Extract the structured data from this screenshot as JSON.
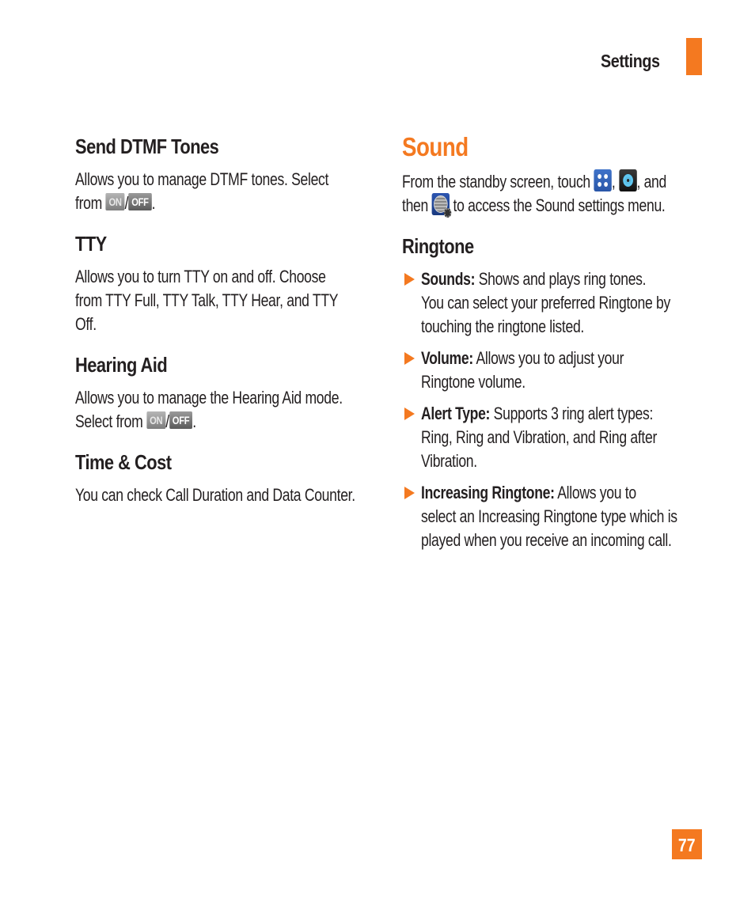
{
  "header": {
    "section_title": "Settings",
    "accent_color": "#f47920"
  },
  "left": {
    "dtmf": {
      "heading": "Send DTMF Tones",
      "line1": "Allows you to manage DTMF tones. Select",
      "line2_prefix": "from",
      "on_label": "ON",
      "separator": "/",
      "off_label": "OFF",
      "suffix": "."
    },
    "tty": {
      "heading": "TTY",
      "lines": [
        "Allows you to turn TTY on and off. Choose",
        "from TTY Full, TTY Talk, TTY Hear, and TTY",
        "Off."
      ]
    },
    "hearing_aid": {
      "heading": "Hearing Aid",
      "line1": "Allows you to manage the Hearing Aid mode.",
      "line2_prefix": "Select from",
      "on_label": "ON",
      "separator": "/",
      "off_label": "OFF",
      "suffix": "."
    },
    "time_cost": {
      "heading": "Time & Cost",
      "line1": "You can check Call Duration and Data Counter."
    }
  },
  "right": {
    "sound": {
      "heading": "Sound",
      "line1_prefix": "From the standby screen, touch",
      "line1_comma": ",",
      "line1_suffix": ", and",
      "line2_prefix": "then",
      "line2_suffix": "to access the Sound settings menu.",
      "icons": [
        "apps-grid-icon",
        "settings-gear-icon",
        "sound-settings-icon"
      ]
    },
    "ringtone": {
      "heading": "Ringtone",
      "items": [
        {
          "term": "Sounds:",
          "lines": [
            " Shows and plays ring tones.",
            "You can select your preferred Ringtone by",
            "touching the ringtone listed."
          ]
        },
        {
          "term": "Volume:",
          "lines": [
            " Allows you to adjust your",
            "Ringtone volume."
          ]
        },
        {
          "term": "Alert Type:",
          "lines": [
            " Supports 3 ring alert types:",
            "Ring, Ring and Vibration, and Ring after",
            "Vibration."
          ]
        },
        {
          "term": "Increasing Ringtone:",
          "lines": [
            " Allows you to",
            "select an Increasing Ringtone type which is",
            "played when you receive an incoming call."
          ]
        }
      ]
    }
  },
  "footer": {
    "page_number": "77"
  }
}
